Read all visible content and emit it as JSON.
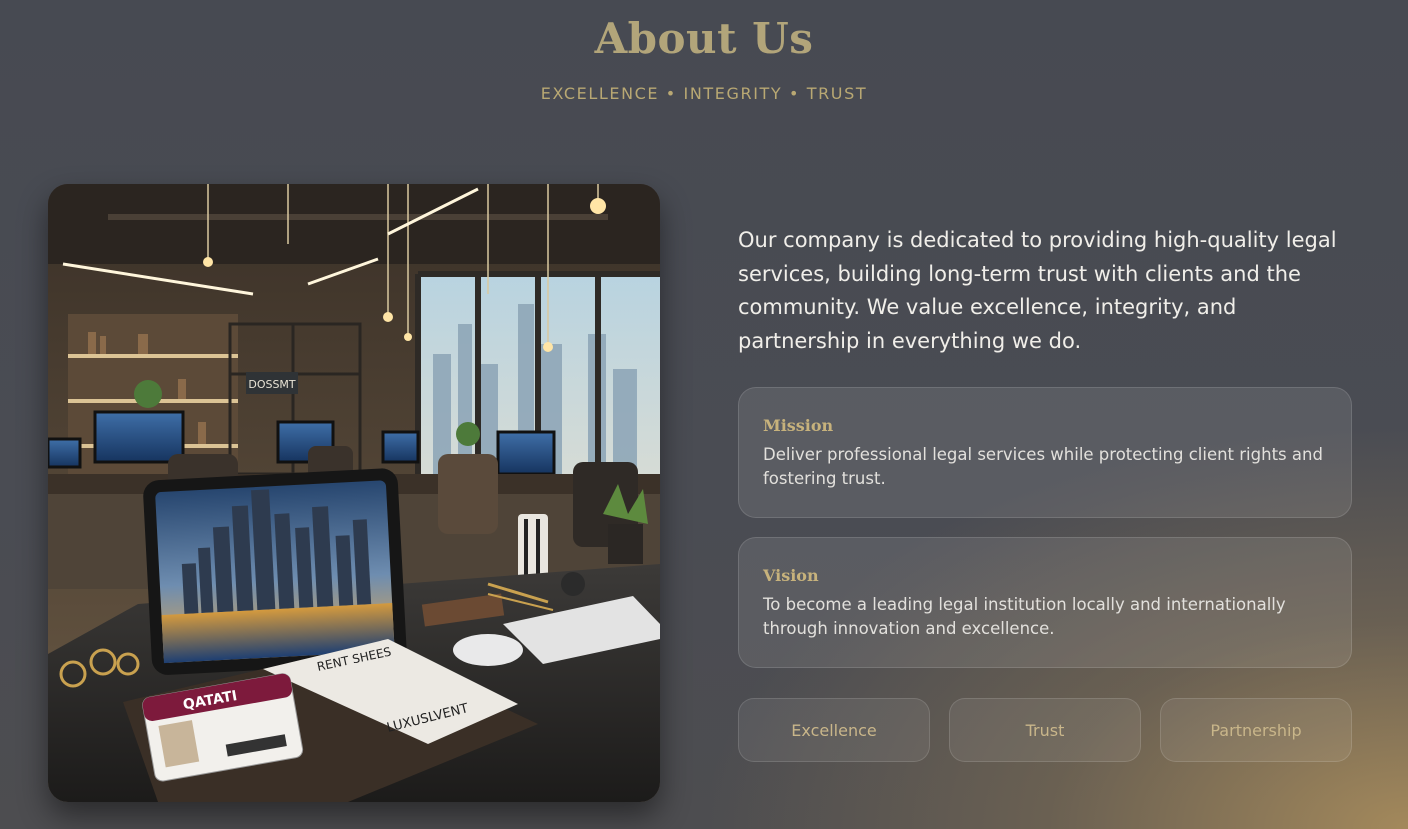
{
  "header": {
    "title": "About Us",
    "tagline": "EXCELLENCE • INTEGRITY • TRUST"
  },
  "hero_image": {
    "signage_1": "DOSSMT",
    "id_card_brand": "QATATI",
    "document_header": "RENT SHEES",
    "document_footer": "LUXUSLVENT"
  },
  "intro": "Our company is dedicated to providing high-quality legal services, building long-term trust with clients and the community. We value excellence, integrity, and partnership in everything we do.",
  "cards": [
    {
      "title": "Mission",
      "body": "Deliver professional legal services while protecting client rights and fostering trust."
    },
    {
      "title": "Vision",
      "body": "To become a leading legal institution locally and internationally through innovation and excellence."
    }
  ],
  "values": [
    "Excellence",
    "Trust",
    "Partnership"
  ],
  "colors": {
    "accent_gold": "#b2a57a",
    "background": "#474a52"
  }
}
